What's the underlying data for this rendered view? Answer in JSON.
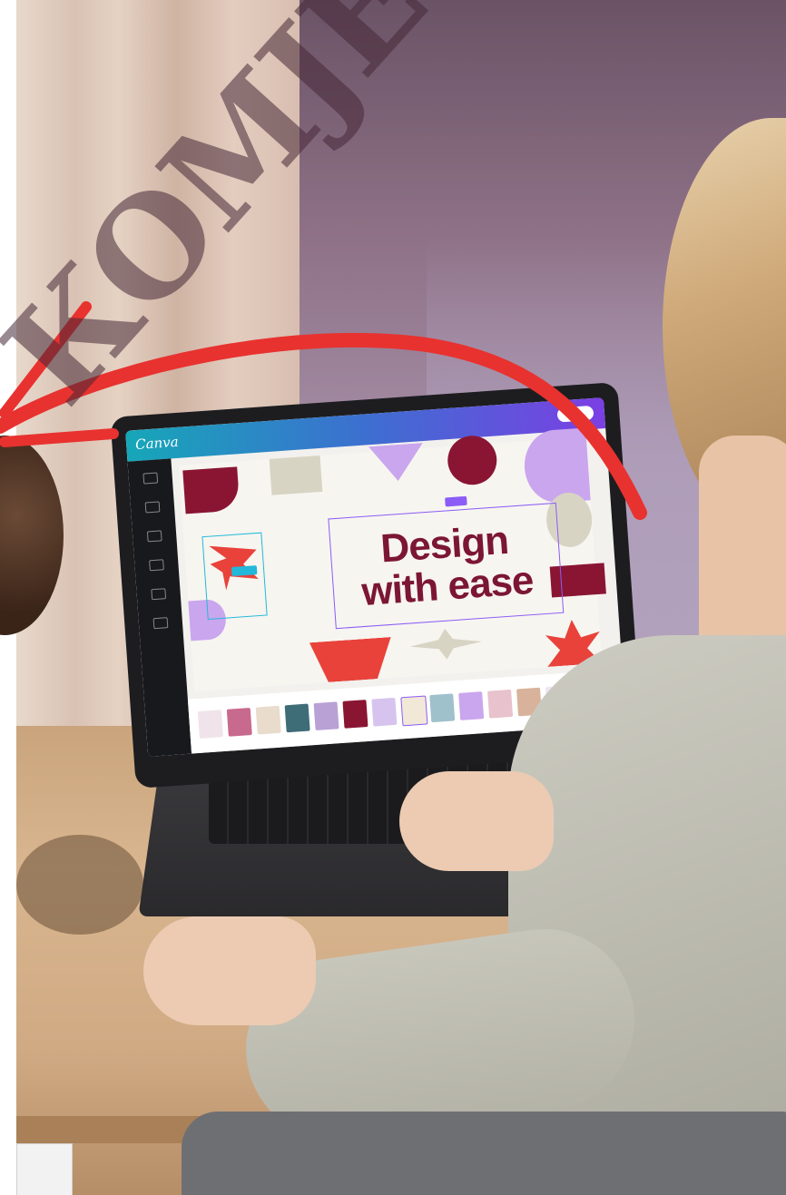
{
  "screen": {
    "app_logo": "Canva",
    "headline_line1": "Design",
    "headline_line2": "with ease"
  },
  "watermark": {
    "text": "КОМЈЕ"
  },
  "colors": {
    "headline": "#7c1635",
    "arrow": "#e8322f",
    "selection": "#22b8d9",
    "accent_purple": "#8b5cf6"
  }
}
